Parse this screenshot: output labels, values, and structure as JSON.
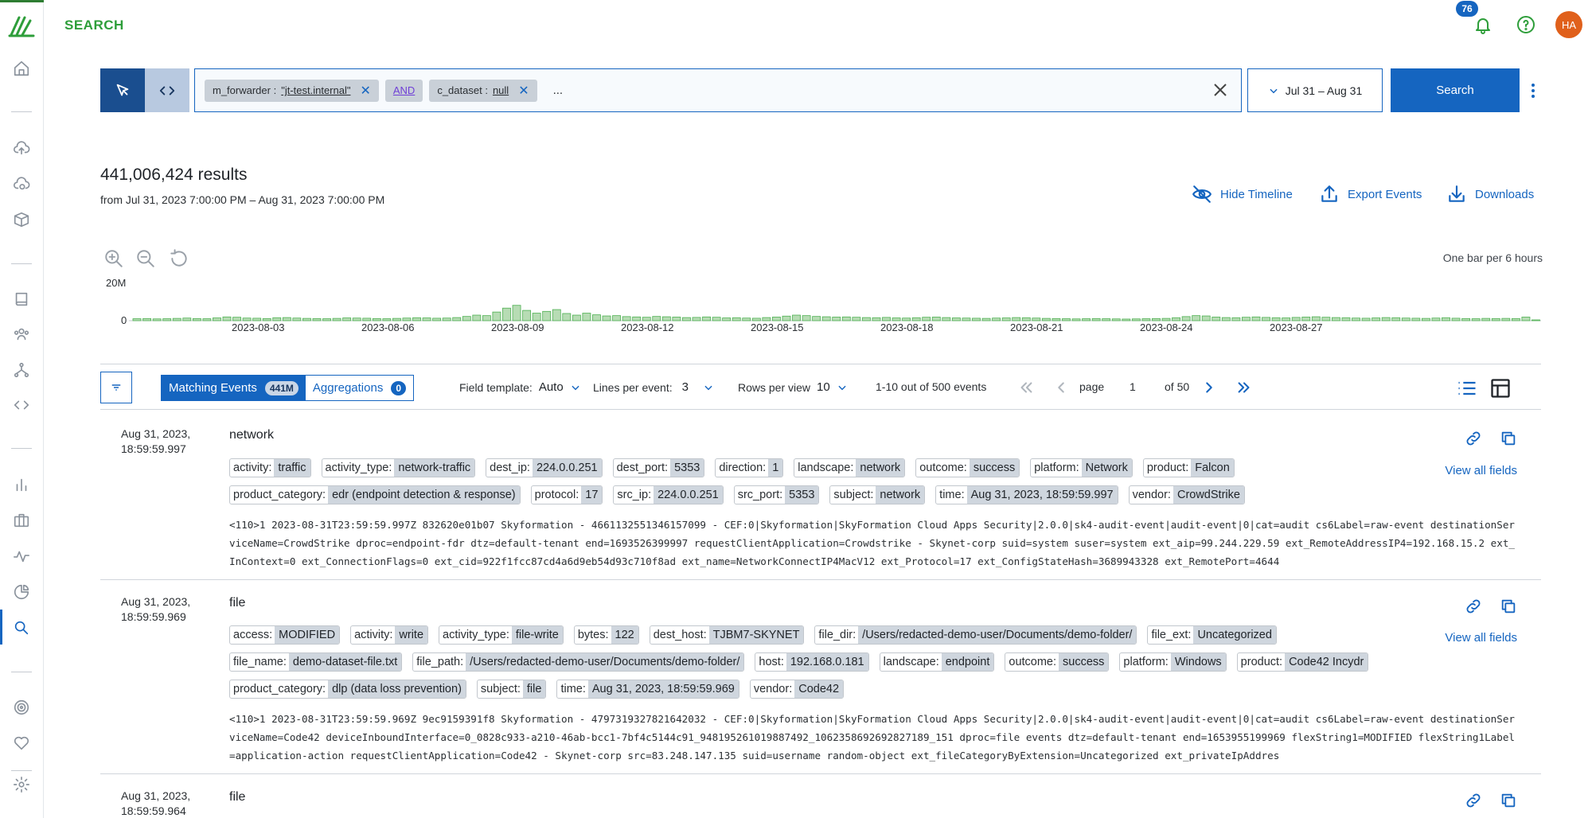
{
  "app": {
    "page_title": "SEARCH",
    "notifications_count": "76",
    "avatar_initials": "HA",
    "accent_color": "#1565c0",
    "brand_color": "#2e9e3a"
  },
  "nav": {
    "icons": [
      "home-icon",
      "cloud-upload-icon",
      "cloud-sync-icon",
      "box-icon",
      "book-icon",
      "people-icon",
      "fork-icon",
      "code-icon",
      "bar-chart-icon",
      "briefcase-icon",
      "activity-icon",
      "pie-chart-icon",
      "search-icon",
      "target-icon",
      "heart-icon",
      "gear-icon"
    ]
  },
  "search": {
    "chips": [
      {
        "key": "m_forwarder : ",
        "value": "\"jt-test.internal\""
      },
      {
        "key": "c_dataset : ",
        "value": "null"
      }
    ],
    "operator": "AND",
    "more": "...",
    "date_range": "Jul 31 – Aug 31",
    "search_label": "Search"
  },
  "results": {
    "count": "441,006,424 results",
    "range": "from Jul 31, 2023 7:00:00 PM – Aug 31, 2023 7:00:00 PM",
    "hide_timeline": "Hide Timeline",
    "export_events": "Export Events",
    "downloads": "Downloads"
  },
  "timeline": {
    "bar_note": "One bar per 6 hours",
    "y_top": "20M",
    "y_zero": "0"
  },
  "chart_data": {
    "type": "bar",
    "ylim": [
      0,
      20000000
    ],
    "tick_labels": [
      "2023-08-03",
      "2023-08-06",
      "2023-08-09",
      "2023-08-12",
      "2023-08-15",
      "2023-08-18",
      "2023-08-21",
      "2023-08-24",
      "2023-08-27"
    ],
    "values": [
      1.2,
      1.3,
      1.1,
      1.2,
      1.4,
      1.6,
      1.3,
      1.2,
      1.7,
      2.3,
      2.1,
      1.6,
      1.5,
      1.3,
      1.8,
      1.9,
      1.6,
      1.4,
      1.3,
      1.2,
      1.4,
      1.7,
      1.6,
      1.5,
      1.3,
      1.2,
      1.4,
      1.6,
      1.8,
      1.7,
      1.5,
      1.6,
      1.9,
      2.6,
      3.4,
      3.1,
      5.3,
      7.7,
      9.4,
      6.3,
      4.6,
      5.7,
      6.8,
      4.4,
      3.4,
      4.6,
      3.6,
      2.9,
      3.1,
      2.5,
      2.3,
      2.1,
      2.6,
      2.4,
      2.2,
      1.9,
      2.0,
      2.3,
      2.1,
      1.7,
      1.8,
      1.6,
      1.5,
      1.9,
      2.2,
      2.8,
      3.4,
      3.1,
      2.6,
      2.4,
      2.2,
      2.3,
      2.1,
      1.9,
      1.8,
      2.0,
      1.7,
      1.6,
      1.8,
      2.1,
      2.2,
      1.9,
      1.7,
      1.6,
      1.5,
      1.4,
      1.6,
      1.7,
      1.9,
      1.8,
      1.6,
      1.4,
      1.3,
      1.2,
      1.1,
      1.2,
      1.3,
      1.2,
      1.1,
      1.0,
      1.1,
      1.2,
      1.3,
      1.4,
      1.8,
      2.5,
      3.1,
      2.9,
      2.2,
      1.9,
      1.8,
      2.1,
      2.3,
      2.0,
      1.8,
      1.7,
      2.0,
      2.2,
      2.4,
      2.1,
      1.9,
      1.8,
      1.6,
      1.5,
      1.7,
      1.9,
      1.8,
      1.6,
      1.5,
      1.4,
      1.6,
      1.8,
      1.5,
      1.3,
      1.2,
      1.4,
      1.3,
      1.4,
      1.3,
      2.2,
      0.4
    ]
  },
  "toolbar": {
    "tab_matching": "Matching Events",
    "tab_matching_count": "441M",
    "tab_aggregations": "Aggregations",
    "tab_aggregations_count": "0",
    "field_template_label": "Field template:",
    "field_template_value": "Auto",
    "lines_label": "Lines per event:",
    "lines_value": "3",
    "rows_label": "Rows per view",
    "rows_value": "10",
    "range_text": "1-10 out of 500 events",
    "page_label": "page",
    "page_value": "1",
    "page_of": "of 50"
  },
  "events": [
    {
      "date": "Aug 31, 2023,",
      "time": "18:59:59.997",
      "title": "network",
      "view_all": "View all fields",
      "fields": [
        {
          "k": "activity:",
          "v": "traffic"
        },
        {
          "k": "activity_type:",
          "v": "network-traffic"
        },
        {
          "k": "dest_ip:",
          "v": "224.0.0.251"
        },
        {
          "k": "dest_port:",
          "v": "5353"
        },
        {
          "k": "direction:",
          "v": "1"
        },
        {
          "k": "landscape:",
          "v": "network"
        },
        {
          "k": "outcome:",
          "v": "success"
        },
        {
          "k": "platform:",
          "v": "Network"
        },
        {
          "k": "product:",
          "v": "Falcon"
        },
        {
          "k": "product_category:",
          "v": "edr (endpoint detection & response)"
        },
        {
          "k": "protocol:",
          "v": "17"
        },
        {
          "k": "src_ip:",
          "v": "224.0.0.251"
        },
        {
          "k": "src_port:",
          "v": "5353"
        },
        {
          "k": "subject:",
          "v": "network"
        },
        {
          "k": "time:",
          "v": "Aug 31, 2023, 18:59:59.997"
        },
        {
          "k": "vendor:",
          "v": "CrowdStrike"
        }
      ],
      "raw": "<110>1 2023-08-31T23:59:59.997Z 832620e01b07 Skyformation - 4661132551346157099 - CEF:0|Skyformation|SkyFormation Cloud Apps Security|2.0.0|sk4-audit-event|audit-event|0|cat=audit cs6Label=raw-event destinationServiceName=CrowdStrike dproc=endpoint-fdr dtz=default-tenant end=1693526399997 requestClientApplication=Crowdstrike - Skynet-corp suid=system suser=system ext_aip=99.244.229.59 ext_RemoteAddressIP4=192.168.15.2 ext_InContext=0 ext_ConnectionFlags=0 ext_cid=922f1fcc87cd4a6d9eb54d93c710f8ad ext_name=NetworkConnectIP4MacV12 ext_Protocol=17 ext_ConfigStateHash=3689943328 ext_RemotePort=4644"
    },
    {
      "date": "Aug 31, 2023,",
      "time": "18:59:59.969",
      "title": "file",
      "view_all": "View all fields",
      "fields": [
        {
          "k": "access:",
          "v": "MODIFIED"
        },
        {
          "k": "activity:",
          "v": "write"
        },
        {
          "k": "activity_type:",
          "v": "file-write"
        },
        {
          "k": "bytes:",
          "v": "122"
        },
        {
          "k": "dest_host:",
          "v": "TJBM7-SKYNET"
        },
        {
          "k": "file_dir:",
          "v": "/Users/redacted-demo-user/Documents/demo-folder/"
        },
        {
          "k": "file_ext:",
          "v": "Uncategorized"
        },
        {
          "k": "file_name:",
          "v": "demo-dataset-file.txt"
        },
        {
          "k": "file_path:",
          "v": "/Users/redacted-demo-user/Documents/demo-folder/"
        },
        {
          "k": "host:",
          "v": "192.168.0.181"
        },
        {
          "k": "landscape:",
          "v": "endpoint"
        },
        {
          "k": "outcome:",
          "v": "success"
        },
        {
          "k": "platform:",
          "v": "Windows"
        },
        {
          "k": "product:",
          "v": "Code42 Incydr"
        },
        {
          "k": "product_category:",
          "v": "dlp (data loss prevention)"
        },
        {
          "k": "subject:",
          "v": "file"
        },
        {
          "k": "time:",
          "v": "Aug 31, 2023, 18:59:59.969"
        },
        {
          "k": "vendor:",
          "v": "Code42"
        }
      ],
      "raw": "<110>1 2023-08-31T23:59:59.969Z 9ec9159391f8 Skyformation - 4797319327821642032 - CEF:0|Skyformation|SkyFormation Cloud Apps Security|2.0.0|sk4-audit-event|audit-event|0|cat=audit cs6Label=raw-event destinationServiceName=Code42 deviceInboundInterface=0_0828c933-a210-46ab-bcc1-7bf4c5144c91_948195261019887492_1062358692692827189_151 dproc=file events dtz=default-tenant end=1653955199969 flexString1=MODIFIED flexString1Label=application-action requestClientApplication=Code42 - Skynet-corp src=83.248.147.135 suid=username random-object ext_fileCategoryByExtension=Uncategorized ext_privateIpAddres"
    },
    {
      "date": "Aug 31, 2023,",
      "time": "18:59:59.964",
      "title": "file"
    }
  ]
}
